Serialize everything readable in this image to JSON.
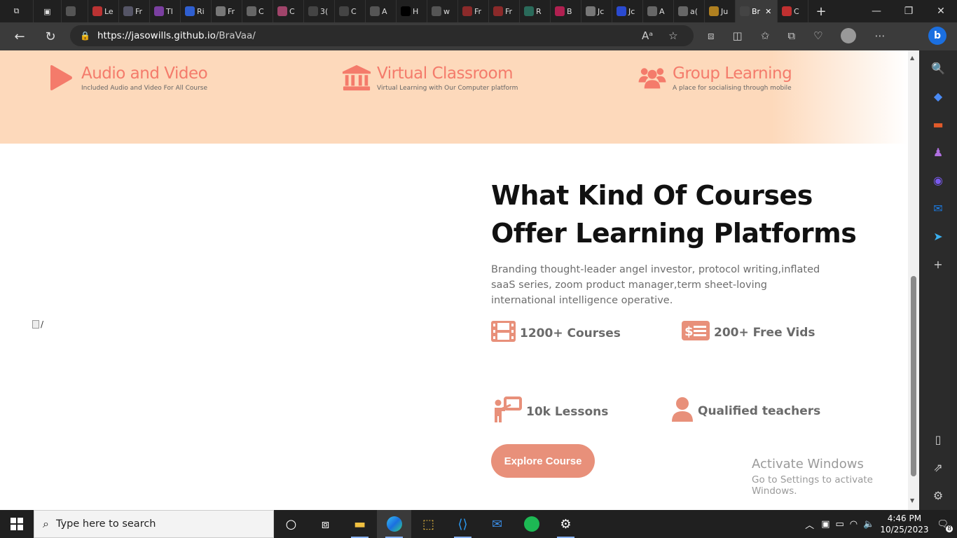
{
  "browser": {
    "tabs": [
      {
        "label": "",
        "color": "#3b3b3b"
      },
      {
        "label": "",
        "color": "#3b3b3b"
      },
      {
        "label": "",
        "color": "#555"
      },
      {
        "label": "Le",
        "color": "#b33"
      },
      {
        "label": "Fr",
        "color": "#556"
      },
      {
        "label": "Tl",
        "color": "#7a3fa0"
      },
      {
        "label": "Ri",
        "color": "#2f5fd0"
      },
      {
        "label": "Fr",
        "color": "#777"
      },
      {
        "label": "C",
        "color": "#666"
      },
      {
        "label": "C",
        "color": "#a0446a"
      },
      {
        "label": "3(",
        "color": "#444"
      },
      {
        "label": "C",
        "color": "#444"
      },
      {
        "label": "A",
        "color": "#555"
      },
      {
        "label": "H",
        "color": "#000"
      },
      {
        "label": "w",
        "color": "#555"
      },
      {
        "label": "Fr",
        "color": "#8b2a2a"
      },
      {
        "label": "Fr",
        "color": "#8b2a2a"
      },
      {
        "label": "R",
        "color": "#2a6a5a"
      },
      {
        "label": "B",
        "color": "#b02050"
      },
      {
        "label": "Jc",
        "color": "#777"
      },
      {
        "label": "Jc",
        "color": "#2a4ad0"
      },
      {
        "label": "A",
        "color": "#666"
      },
      {
        "label": "a(",
        "color": "#666"
      },
      {
        "label": "Ju",
        "color": "#b08020"
      },
      {
        "label": "Br",
        "color": "#444",
        "active": true
      },
      {
        "label": "C",
        "color": "#c03030"
      }
    ],
    "url_host": "https://jasowills.github.io",
    "url_path": "/BraVaa/"
  },
  "features": [
    {
      "title": "Audio and Video",
      "subtitle": "Included Audio and Video For All Course",
      "icon": "play-icon"
    },
    {
      "title": "Virtual Classroom",
      "subtitle": "Virtual Learning with Our Computer platform",
      "icon": "university-icon"
    },
    {
      "title": "Group Learning",
      "subtitle": "A place for socialising through mobile",
      "icon": "users-icon"
    }
  ],
  "section": {
    "heading_line1": "What Kind Of Courses",
    "heading_line2": "Offer Learning Platforms",
    "description": "Branding thought-leader angel investor, protocol writing,inflated saaS series, zoom product manager,term sheet-loving international intelligence operative.",
    "stats": [
      {
        "label": "1200+ Courses",
        "icon": "film-icon"
      },
      {
        "label": "200+ Free Vids",
        "icon": "money-icon"
      },
      {
        "label": "10k Lessons",
        "icon": "teacher-board-icon"
      },
      {
        "label": "Qualified teachers",
        "icon": "user-icon"
      }
    ],
    "button": "Explore Course",
    "broken_image_alt": "/"
  },
  "watermark": {
    "line1": "Activate Windows",
    "line2": "Go to Settings to activate Windows."
  },
  "taskbar": {
    "search_placeholder": "Type here to search",
    "time": "4:46 PM",
    "date": "10/25/2023",
    "notifications": "8"
  },
  "colors": {
    "accent": "#f47b6b",
    "band": "#fdd9bb",
    "button": "#e8907a"
  }
}
